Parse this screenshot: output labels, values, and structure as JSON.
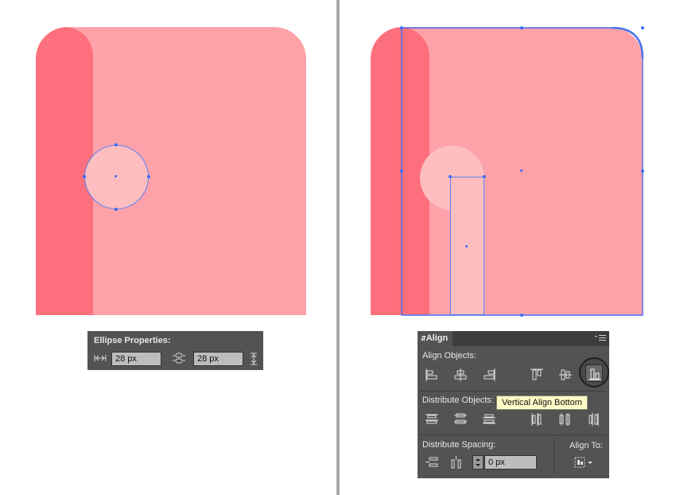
{
  "colors": {
    "shape_light": "#fea2aa",
    "shape_dark": "#fd6f7c",
    "circle_fill": "#febdbf",
    "selection": "#3b6cf2",
    "panel_bg": "#535353",
    "tooltip_bg": "#fffcc8"
  },
  "ellipse_panel": {
    "title": "Ellipse Properties:",
    "width_value": "28 px",
    "height_value": "28 px",
    "width_icon": "width-arrows-icon",
    "height_icon": "height-arrows-icon",
    "constrain_icon": "chain-link-icon"
  },
  "align_panel": {
    "tab_label": "Align",
    "menu_icon": "panel-menu-icon",
    "align_objects_label": "Align Objects:",
    "distribute_objects_label": "Distribute Objects:",
    "distribute_spacing_label": "Distribute Spacing:",
    "align_to_label": "Align To:",
    "spacing_value": "0 px",
    "tooltip": "Vertical Align Bottom",
    "align_buttons": [
      "horizontal-align-left-icon",
      "horizontal-align-center-icon",
      "horizontal-align-right-icon",
      "vertical-align-top-icon",
      "vertical-align-center-icon",
      "vertical-align-bottom-icon"
    ],
    "distribute_buttons": [
      "vertical-distribute-top-icon",
      "vertical-distribute-center-icon",
      "vertical-distribute-bottom-icon",
      "horizontal-distribute-left-icon",
      "horizontal-distribute-center-icon",
      "horizontal-distribute-right-icon"
    ]
  }
}
